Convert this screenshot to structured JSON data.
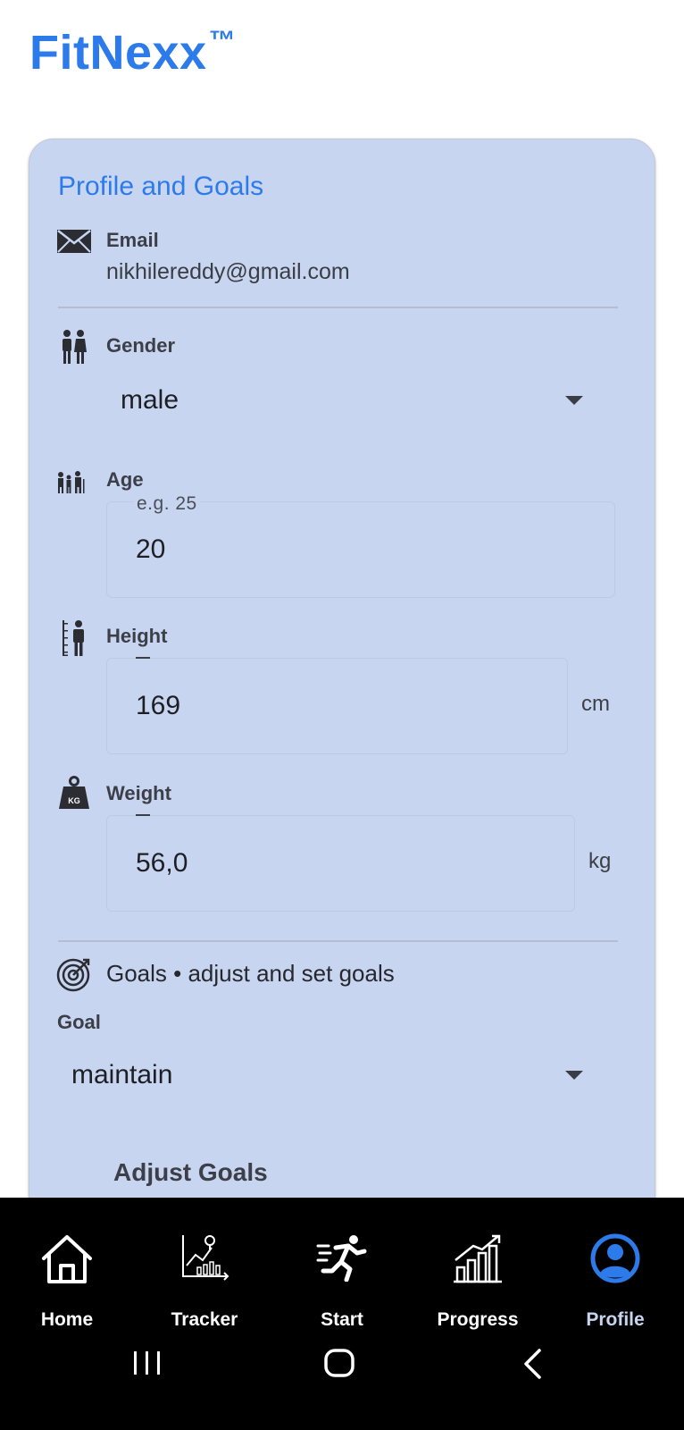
{
  "app": {
    "title": "FitNexx",
    "trademark": "™"
  },
  "profile": {
    "section_title": "Profile and Goals",
    "email": {
      "label": "Email",
      "value": "nikhilereddy@gmail.com",
      "icon": "envelope-icon"
    },
    "gender": {
      "label": "Gender",
      "value": "male",
      "icon": "couple-icon"
    },
    "age": {
      "label": "Age",
      "hint": "e.g. 25",
      "value": "20",
      "icon": "family-icon"
    },
    "height": {
      "label": "Height",
      "value": "169",
      "unit": "cm",
      "icon": "height-measure-icon"
    },
    "weight": {
      "label": "Weight",
      "value": "56,0",
      "unit": "kg",
      "icon": "weight-kg-icon",
      "icon_text": "KG"
    }
  },
  "goals": {
    "header": "Goals • adjust and set goals",
    "icon": "target-icon",
    "goal_label": "Goal",
    "goal_value": "maintain",
    "adjust_label": "Adjust Goals"
  },
  "nav": {
    "items": [
      {
        "label": "Home",
        "icon": "home-icon"
      },
      {
        "label": "Tracker",
        "icon": "tracker-icon"
      },
      {
        "label": "Start",
        "icon": "running-icon"
      },
      {
        "label": "Progress",
        "icon": "progress-chart-icon"
      },
      {
        "label": "Profile",
        "icon": "profile-icon",
        "active": true
      }
    ]
  },
  "colors": {
    "brand": "#2d7bea",
    "card": "#c8d5f1",
    "nav_bg": "#000000",
    "active_tab": "#2d7bea"
  }
}
